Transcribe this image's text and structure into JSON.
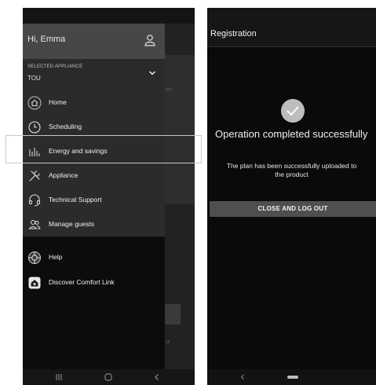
{
  "left_screen": {
    "greeting": "Hi, Emma",
    "selected_appliance_label": "SELECTED APPLIANCE",
    "selected_appliance_value": "TOU",
    "menu_items": [
      {
        "label": "Home",
        "icon": "home-icon"
      },
      {
        "label": "Scheduling",
        "icon": "clock-icon"
      },
      {
        "label": "Energy and savings",
        "icon": "energy-chart-icon"
      },
      {
        "label": "Appliance",
        "icon": "tools-icon"
      },
      {
        "label": "Technical Support",
        "icon": "support-icon"
      },
      {
        "label": "Manage guests",
        "icon": "guests-icon"
      }
    ],
    "extra_items": [
      {
        "label": "Help",
        "icon": "help-icon"
      },
      {
        "label": "Discover Comfort Link",
        "icon": "comfort-link-icon"
      }
    ],
    "background_fragments": [
      "wh",
      "ur"
    ],
    "highlighted_item": "Energy and savings"
  },
  "right_screen": {
    "header_title": "Registration",
    "success_title": "Operation completed successfully",
    "success_description": "The plan has been successfully uploaded to the product",
    "close_button_label": "CLOSE AND LOG OUT"
  },
  "colors": {
    "drawer_header": "#474747",
    "menu_background": "#2b2b2b",
    "close_button": "#4f4f4f",
    "highlight_border": "#c8c8c8"
  }
}
